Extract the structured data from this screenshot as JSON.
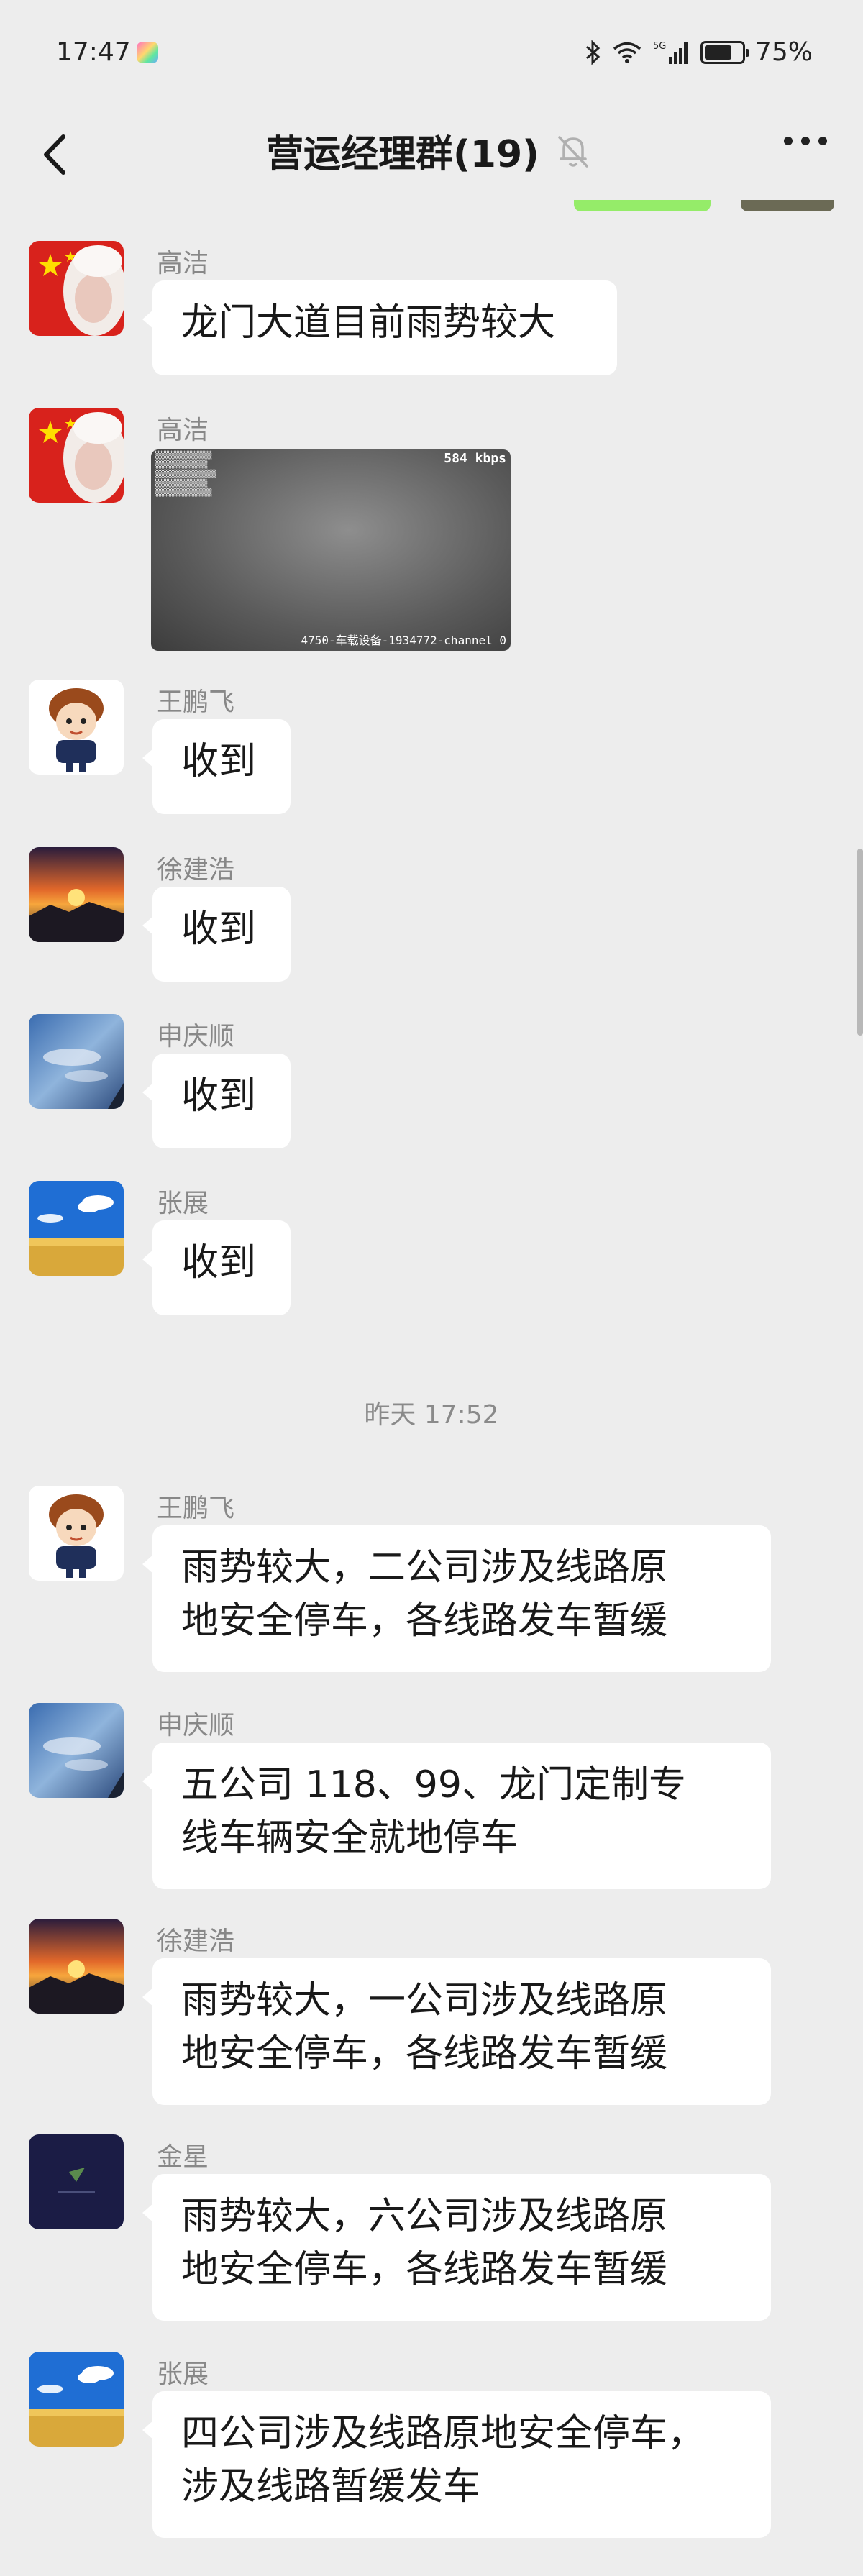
{
  "status_bar": {
    "time": "17:47",
    "battery_text": "75%",
    "battery_level": 0.75,
    "network": "5G"
  },
  "header": {
    "title": "营运经理群(19)"
  },
  "messages": [
    {
      "sender": "高洁",
      "text": "龙门大道目前雨势较大"
    },
    {
      "sender": "高洁",
      "video_kbps": "584 kbps",
      "video_label": "4750-车载设备-1934772-channel 0"
    },
    {
      "sender": "王鹏飞",
      "text": "收到"
    },
    {
      "sender": "徐建浩",
      "text": "收到"
    },
    {
      "sender": "申庆顺",
      "text": "收到"
    },
    {
      "sender": "张展",
      "text": "收到"
    },
    {
      "sender": "王鹏飞",
      "text_line1": "雨势较大，二公司涉及线路原",
      "text_line2": "地安全停车，各线路发车暂缓"
    },
    {
      "sender": "申庆顺",
      "text_line1": "五公司 118、99、龙门定制专",
      "text_line2": "线车辆安全就地停车"
    },
    {
      "sender": "徐建浩",
      "text_line1": "雨势较大，一公司涉及线路原",
      "text_line2": "地安全停车，各线路发车暂缓"
    },
    {
      "sender": "金星",
      "text_line1": "雨势较大，六公司涉及线路原",
      "text_line2": "地安全停车，各线路发车暂缓"
    },
    {
      "sender": "张展",
      "text_line1": "四公司涉及线路原地安全停车，",
      "text_line2": "涉及线路暂缓发车"
    }
  ],
  "time_separator": "昨天 17:52",
  "colors": {
    "background": "#ededed",
    "bubble": "#ffffff",
    "sender_name": "#888888"
  }
}
